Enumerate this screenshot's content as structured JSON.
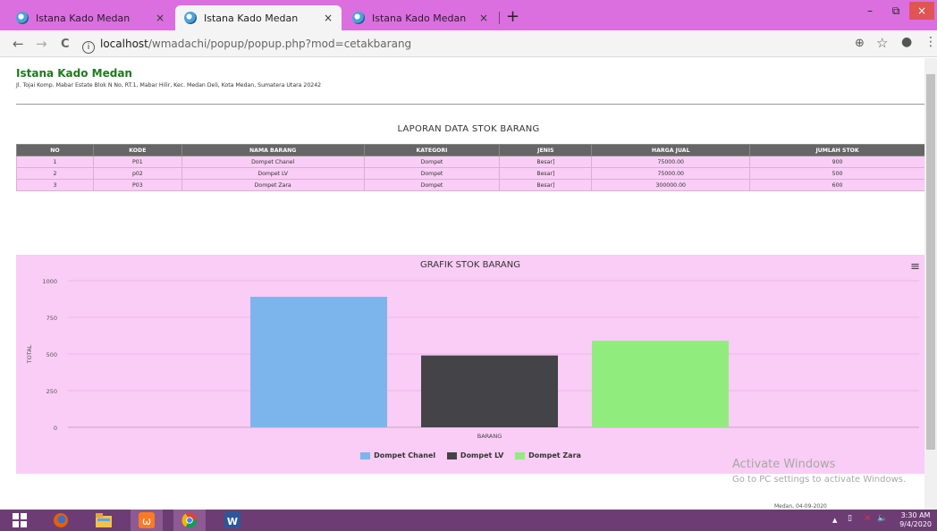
{
  "browser": {
    "tabs": [
      {
        "title": "Istana Kado Medan",
        "close": "×"
      },
      {
        "title": "Istana Kado Medan",
        "close": "×"
      },
      {
        "title": "Istana Kado Medan",
        "close": "×"
      }
    ],
    "new_tab": "+",
    "window_buttons": {
      "minimize": "–",
      "maximize": "⧉",
      "close": "×"
    },
    "nav": {
      "back": "←",
      "forward": "→",
      "reload": "C"
    },
    "url": {
      "info": "i",
      "host": "localhost",
      "path": "/wmadachi/popup/popup.php?mod=cetakbarang"
    },
    "right_icons": {
      "zoom": "⊕",
      "star": "☆",
      "profile": "●",
      "menu": "⋮"
    }
  },
  "header": {
    "company": "Istana Kado Medan",
    "address": "Jl. Tojai Komp. Mabar Estate Blok N No, RT.1, Mabar Hilir, Kec. Medan Deli, Kota Medan, Sumatera Utara 20242"
  },
  "report": {
    "title": "LAPORAN DATA STOK BARANG",
    "columns": [
      "NO",
      "KODE",
      "NAMA BARANG",
      "KATEGORI",
      "JENIS",
      "HARGA JUAL",
      "JUMLAH STOK"
    ],
    "rows": [
      [
        "1",
        "P01",
        "Dompet Chanel",
        "Dompet",
        "Besar]",
        "75000.00",
        "900"
      ],
      [
        "2",
        "p02",
        "Dompet LV",
        "Dompet",
        "Besar]",
        "75000.00",
        "500"
      ],
      [
        "3",
        "P03",
        "Dompet Zara",
        "Dompet",
        "Besar]",
        "300000.00",
        "600"
      ]
    ]
  },
  "chart_data": {
    "type": "bar",
    "title": "GRAFIK STOK BARANG",
    "xlabel": "BARANG",
    "ylabel": "TOTAL",
    "ylim": [
      0,
      1000
    ],
    "yticks": [
      0,
      250,
      500,
      750,
      1000
    ],
    "grid": true,
    "legend_position": "bottom-center",
    "series": [
      {
        "name": "Dompet Chanel",
        "value": 890,
        "color": "#7cb5ec"
      },
      {
        "name": "Dompet LV",
        "value": 490,
        "color": "#434348"
      },
      {
        "name": "Dompet Zara",
        "value": 590,
        "color": "#90ed7d"
      }
    ],
    "menu_icon": "≡"
  },
  "watermark": {
    "line1": "Activate Windows",
    "line2": "Go to PC settings to activate Windows."
  },
  "footer": {
    "date": "Medan, 04-09-2020"
  },
  "taskbar": {
    "apps": [
      "windows-start",
      "firefox",
      "file-explorer",
      "xampp",
      "chrome",
      "word"
    ],
    "tray": {
      "chevron": "▲",
      "network": "▯",
      "speaker": "🔈"
    },
    "clock": {
      "time": "3:30 AM",
      "date": "9/4/2020"
    }
  }
}
